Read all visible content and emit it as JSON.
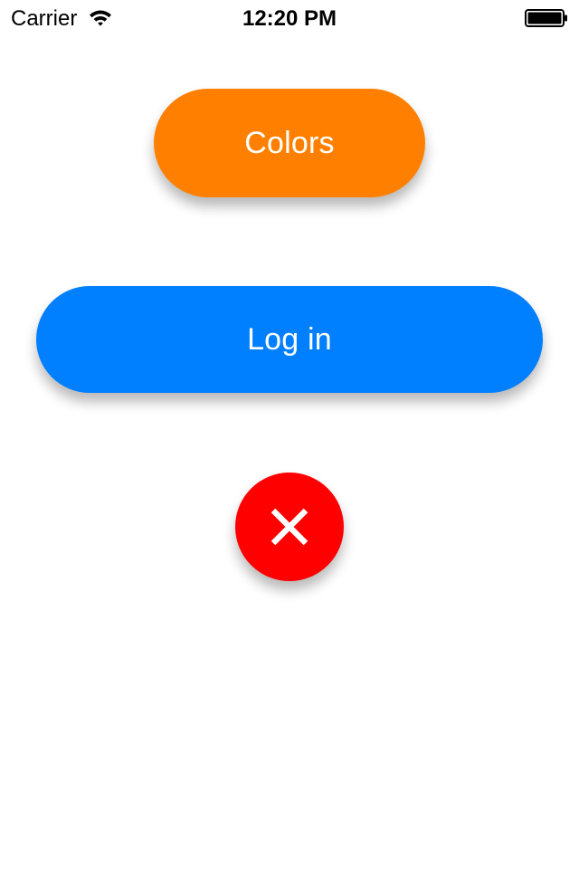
{
  "status_bar": {
    "carrier": "Carrier",
    "time": "12:20 PM",
    "wifi_icon": "wifi-icon",
    "battery_icon": "battery-icon"
  },
  "buttons": {
    "colors": {
      "label": "Colors",
      "color": "#FF8000"
    },
    "login": {
      "label": "Log in",
      "color": "#007FFF"
    },
    "close": {
      "icon": "close-icon",
      "color": "#FF0000"
    }
  }
}
